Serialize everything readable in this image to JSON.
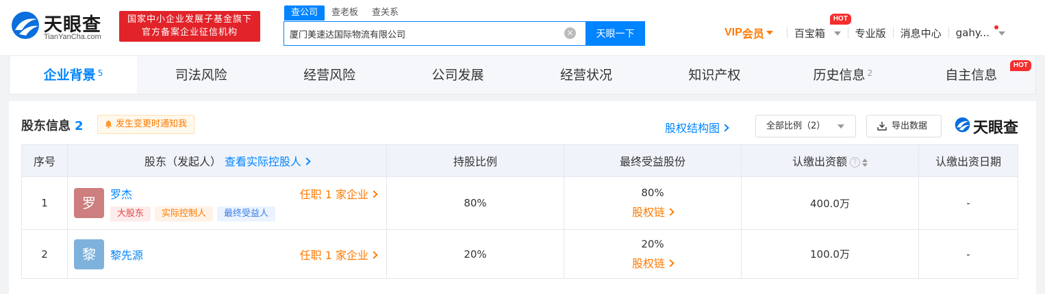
{
  "header": {
    "logo_name": "天眼查",
    "logo_sub": "TianYanCha.com",
    "banner_line1": "国家中小企业发展子基金旗下",
    "banner_line2": "官方备案企业征信机构",
    "search_tabs": [
      "查公司",
      "查老板",
      "查关系"
    ],
    "search_value": "厦门美速达国际物流有限公司",
    "search_button": "天眼一下",
    "nav": {
      "vip_en": "VIP",
      "vip_cn": "会员",
      "toolbox": "百宝箱",
      "toolbox_badge": "HOT",
      "pro": "专业版",
      "messages": "消息中心",
      "user": "gahy..."
    }
  },
  "tabs": [
    {
      "label": "企业背景",
      "count": "5"
    },
    {
      "label": "司法风险",
      "count": ""
    },
    {
      "label": "经营风险",
      "count": ""
    },
    {
      "label": "公司发展",
      "count": ""
    },
    {
      "label": "经营状况",
      "count": ""
    },
    {
      "label": "知识产权",
      "count": ""
    },
    {
      "label": "历史信息",
      "count": "2"
    },
    {
      "label": "自主信息",
      "count": "",
      "badge": "HOT"
    }
  ],
  "section": {
    "title": "股东信息",
    "count": "2",
    "notify": "发生变更时通知我",
    "structure_link": "股权结构图",
    "ratio_select": "全部比例（2）",
    "export": "导出数据",
    "brand": "天眼查"
  },
  "table": {
    "headers": {
      "no": "序号",
      "holder": "股东（发起人）",
      "holder_link": "查看实际控股人",
      "ratio": "持股比例",
      "final": "最终受益股份",
      "amount": "认缴出资额",
      "date": "认缴出资日期"
    },
    "rows": [
      {
        "no": "1",
        "avatar": "罗",
        "name": "罗杰",
        "tags": [
          "大股东",
          "实际控制人",
          "最终受益人"
        ],
        "job": "任职 1 家企业",
        "ratio": "80%",
        "final_pct": "80%",
        "chain": "股权链",
        "amount": "400.0万",
        "date": "-"
      },
      {
        "no": "2",
        "avatar": "黎",
        "name": "黎先源",
        "tags": [],
        "job": "任职 1 家企业",
        "ratio": "20%",
        "final_pct": "20%",
        "chain": "股权链",
        "amount": "100.0万",
        "date": "-"
      }
    ]
  },
  "colors": {
    "accent": "#0084ff",
    "orange": "#ff7a00",
    "hot": "#f52e2e",
    "avatar_1": "#cd7e7e",
    "avatar_2": "#7fb1dd"
  }
}
